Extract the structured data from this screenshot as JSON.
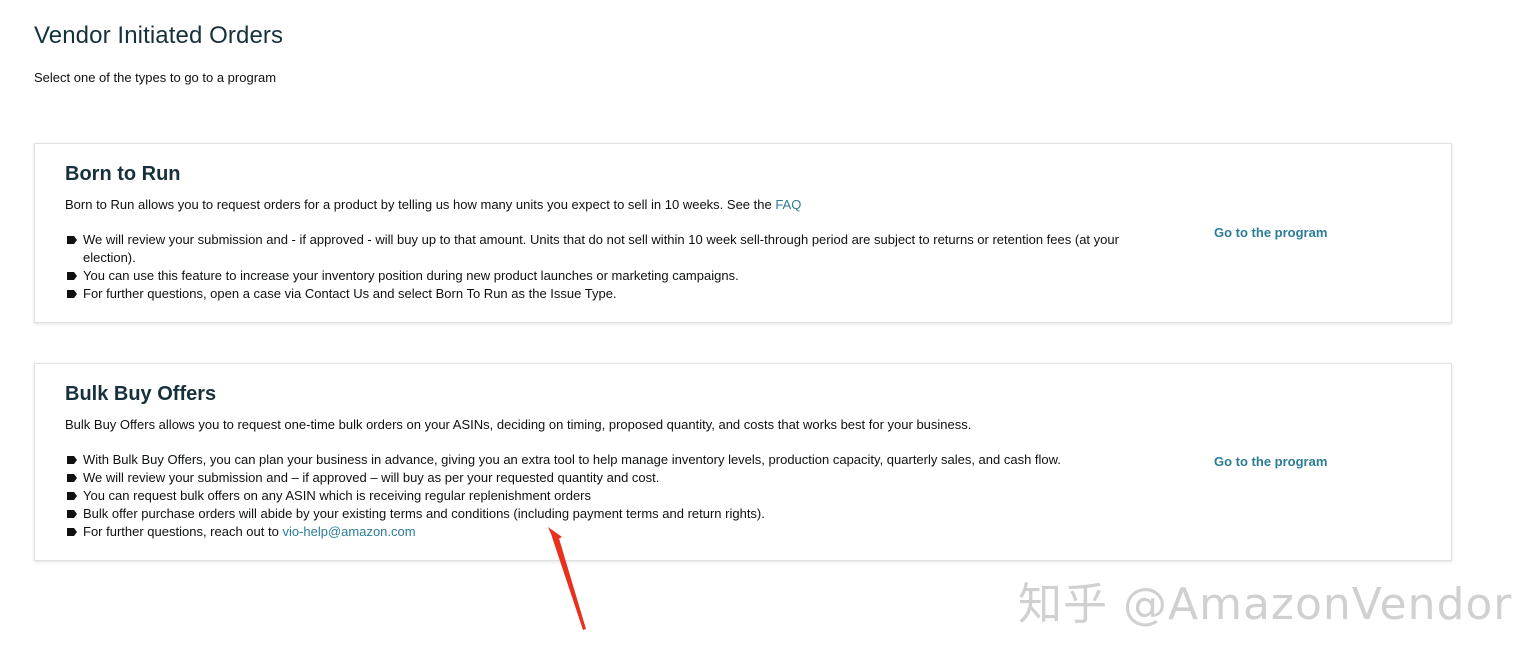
{
  "page": {
    "title": "Vendor Initiated Orders",
    "subtitle": "Select one of the types to go to a program"
  },
  "cards": [
    {
      "title": "Born to Run",
      "description": "Born to Run allows you to request orders for a product by telling us how many units you expect to sell in 10 weeks. See the ",
      "description_link": "FAQ",
      "bullets": [
        "We will review your submission and - if approved - will buy up to that amount. Units that do not sell within 10 week sell-through period are subject to returns or retention fees (at your election).",
        "You can use this feature to increase your inventory position during new product launches or marketing campaigns.",
        "For further questions, open a case via Contact Us and select Born To Run as the Issue Type."
      ],
      "cta": "Go to the program"
    },
    {
      "title": "Bulk Buy Offers",
      "description": "Bulk Buy Offers allows you to request one-time bulk orders on your ASINs, deciding on timing, proposed quantity, and costs that works best for your business.",
      "bullets": [
        "With Bulk Buy Offers, you can plan your business in advance, giving you an extra tool to help manage inventory levels, production capacity, quarterly sales, and cash flow.",
        "We will review your submission and – if approved – will buy as per your requested quantity and cost.",
        "You can request bulk offers on any ASIN which is receiving regular replenishment orders",
        "Bulk offer purchase orders will abide by your existing terms and conditions (including payment terms and return rights)."
      ],
      "last_bullet_text": "For further questions, reach out to ",
      "last_bullet_link": "vio-help@amazon.com",
      "cta": "Go to the program"
    }
  ],
  "watermark": "知乎 @AmazonVendor",
  "colors": {
    "title": "#16313b",
    "link": "#2b7d96",
    "arrow": "#e8301c"
  }
}
